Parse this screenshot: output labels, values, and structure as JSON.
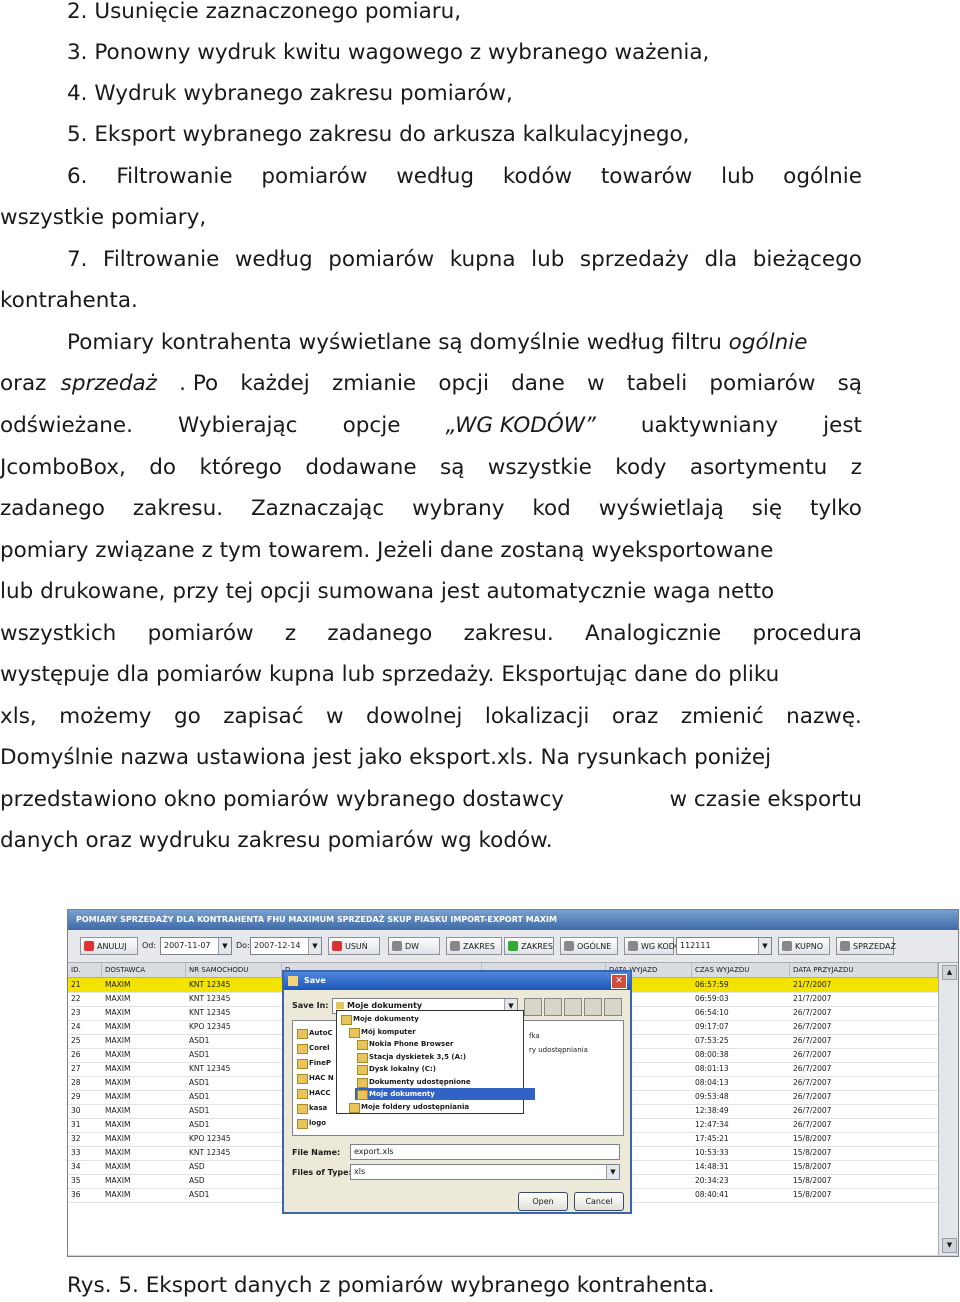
{
  "text": {
    "l1": "2.  Usunięcie zaznaczonego pomiaru,",
    "l2": "3.  Ponowny wydruk kwitu wagowego z wybranego ważenia,",
    "l3": "4.  Wydruk  wybranego zakresu pomiarów,",
    "l4": "5.  Eksport wybranego zakresu do arkusza kalkulacyjnego,",
    "l5": [
      "6.",
      "Filtrowanie",
      "pomiarów",
      "według",
      "kodów",
      "towarów",
      "lub",
      "ogólnie"
    ],
    "l6": "wszystkie pomiary,",
    "l7": [
      "7.",
      "Filtrowanie",
      "według",
      "pomiarów",
      "kupna",
      "lub",
      "sprzedaży",
      "dla",
      "bieżącego"
    ],
    "l8": "kontrahenta.",
    "l9a": "Pomiary kontrahenta wyświetlane są domyślnie według filtru ",
    "l9b": "ogólnie",
    "l10a": "oraz",
    "l10b": "sprzedaż",
    "l10c": [
      ". Po",
      "każdej",
      "zmianie",
      "opcji",
      "dane",
      "w",
      "tabeli",
      "pomiarów",
      "są"
    ],
    "l11a": [
      "odświeżane.",
      "Wybierając",
      "opcje"
    ],
    "l11b": "„WG KODÓW”",
    "l11c": [
      "uaktywniany",
      "jest"
    ],
    "l12": [
      "JcomboBox,",
      "do",
      "którego",
      "dodawane",
      "są",
      "wszystkie",
      "kody",
      "asortymentu",
      "z"
    ],
    "l13": [
      "zadanego",
      "zakresu.",
      "Zaznaczając",
      "wybrany",
      "kod",
      "wyświetlają",
      "się",
      "tylko"
    ],
    "l14": "pomiary związane z tym towarem. Jeżeli dane zostaną wyeksportowane",
    "l15": "lub drukowane, przy tej opcji sumowana jest automatycznie waga netto",
    "l16": [
      "wszystkich",
      "pomiarów",
      "z",
      "zadanego",
      "zakresu.",
      "Analogicznie",
      "procedura"
    ],
    "l17": "występuje dla pomiarów kupna lub sprzedaży. Eksportując dane do pliku",
    "l18": [
      "xls,",
      "możemy",
      "go",
      "zapisać",
      "w",
      "dowolnej",
      "lokalizacji",
      "oraz",
      "zmienić",
      "nazwę."
    ],
    "l19": "Domyślnie nazwa ustawiona jest jako eksport.xls. Na rysunkach poniżej",
    "l20a": "przedstawiono okno pomiarów wybranego dostawcy",
    "l20b": "w czasie eksportu",
    "l21": "danych oraz wydruku zakresu pomiarów wg kodów.",
    "caption": "Rys. 5.  Eksport danych z pomiarów wybranego kontrahenta."
  },
  "app": {
    "title": "POMIARY SPRZEDAŻY DLA KONTRAHENTA FHU MAXIMUM SPRZEDAŻ SKUP PIASKU IMPORT-EXPORT MAXIM",
    "toolbar": {
      "cancel": "ANULUJ",
      "from_label": "Od:",
      "from_value": "2007-11-07",
      "to_label": "Do:",
      "to_value": "2007-12-14",
      "delete": "USUŃ",
      "reprint": "DW",
      "range": "ZAKRES",
      "range2": "ZAKRES",
      "general": "OGÓLNE",
      "by_code": "WG KODÓW",
      "code_value": "112111",
      "buy": "KUPNO",
      "sell": "SPRZEDAŻ"
    },
    "columns": [
      "ID.",
      "DOSTAWCA",
      "NR SAMOCHODU",
      "D.",
      "",
      "DATA WYJAZD",
      "CZAS WYJAZDU",
      "DATA PRZYJAZDU"
    ],
    "rows": [
      {
        "id": "21",
        "dostawca": "MAXIM",
        "nr": "KNT 12345",
        "czas": "06:57:59",
        "data": "21/7/2007"
      },
      {
        "id": "22",
        "dostawca": "MAXIM",
        "nr": "KNT 12345",
        "czas": "06:59:03",
        "data": "21/7/2007"
      },
      {
        "id": "23",
        "dostawca": "MAXIM",
        "nr": "KNT 12345",
        "czas": "06:54:10",
        "data": "26/7/2007"
      },
      {
        "id": "24",
        "dostawca": "MAXIM",
        "nr": "KPO 12345",
        "czas": "09:17:07",
        "data": "26/7/2007"
      },
      {
        "id": "25",
        "dostawca": "MAXIM",
        "nr": "ASD1",
        "czas": "07:53:25",
        "data": "26/7/2007"
      },
      {
        "id": "26",
        "dostawca": "MAXIM",
        "nr": "ASD1",
        "czas": "08:00:38",
        "data": "26/7/2007"
      },
      {
        "id": "27",
        "dostawca": "MAXIM",
        "nr": "KNT 12345",
        "czas": "08:01:13",
        "data": "26/7/2007"
      },
      {
        "id": "28",
        "dostawca": "MAXIM",
        "nr": "ASD1",
        "czas": "08:04:13",
        "data": "26/7/2007"
      },
      {
        "id": "29",
        "dostawca": "MAXIM",
        "nr": "ASD1",
        "czas": "09:53:48",
        "data": "26/7/2007"
      },
      {
        "id": "30",
        "dostawca": "MAXIM",
        "nr": "ASD1",
        "czas": "12:38:49",
        "data": "26/7/2007"
      },
      {
        "id": "31",
        "dostawca": "MAXIM",
        "nr": "ASD1",
        "czas": "12:47:34",
        "data": "26/7/2007"
      },
      {
        "id": "32",
        "dostawca": "MAXIM",
        "nr": "KPO 12345",
        "czas": "17:45:21",
        "data": "15/8/2007"
      },
      {
        "id": "33",
        "dostawca": "MAXIM",
        "nr": "KNT 12345",
        "czas": "10:53:33",
        "data": "15/8/2007"
      },
      {
        "id": "34",
        "dostawca": "MAXIM",
        "nr": "ASD",
        "czas": "14:48:31",
        "data": "15/8/2007"
      },
      {
        "id": "35",
        "dostawca": "MAXIM",
        "nr": "ASD",
        "czas": "20:34:23",
        "data": "15/8/2007"
      },
      {
        "id": "36",
        "dostawca": "MAXIM",
        "nr": "ASD1",
        "czas": "08:40:41",
        "data": "15/8/2007"
      }
    ],
    "dialog": {
      "title": "Save",
      "save_in_label": "Save In:",
      "save_in_value": "Moje dokumenty",
      "options": [
        "Moje dokumenty",
        "Mój komputer",
        "Nokia Phone Browser",
        "Stacja dyskietek 3,5 (A:)",
        "Dysk lokalny (C:)",
        "Dokumenty udostępnione",
        "Moje dokumenty",
        "Moje foldery udostępniania"
      ],
      "list_left": [
        "AutoC",
        "Corel",
        "FineP",
        "HAC N",
        "HACC",
        "kasa",
        "logo"
      ],
      "list_right": [
        "fka",
        "ry udostępniania"
      ],
      "file_name_label": "File Name:",
      "file_name_value": "export.xls",
      "file_type_label": "Files of Type:",
      "file_type_value": "xls",
      "open": "Open",
      "cancel": "Cancel"
    }
  },
  "colors": {
    "selected_row": "#f2e400",
    "title_bar": "#3d6aa8"
  }
}
